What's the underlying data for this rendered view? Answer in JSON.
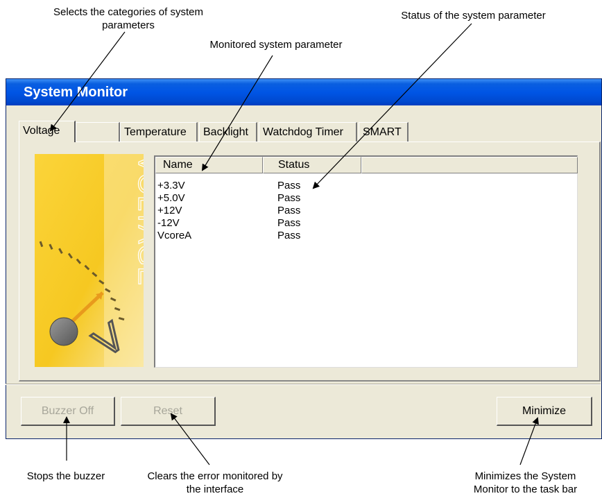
{
  "callouts": {
    "categories": "Selects the categories of system parameters",
    "monitored": "Monitored system parameter",
    "status": "Status of the system parameter",
    "buzzer": "Stops the buzzer",
    "reset": "Clears the error monitored by the interface",
    "minimize": "Minimizes the System Monitor to the task bar"
  },
  "window": {
    "title": "System Monitor"
  },
  "tabs": [
    {
      "label": "Voltage",
      "active": true
    },
    {
      "label": ""
    },
    {
      "label": "Temperature"
    },
    {
      "label": "Backlight"
    },
    {
      "label": "Watchdog Timer"
    },
    {
      "label": "SMART"
    }
  ],
  "artwork": {
    "text": "VOLTAGE",
    "letter": "V"
  },
  "list": {
    "columns": [
      "Name",
      "Status"
    ],
    "rows": [
      {
        "name": "+3.3V",
        "status": "Pass"
      },
      {
        "name": "+5.0V",
        "status": "Pass"
      },
      {
        "name": "+12V",
        "status": "Pass"
      },
      {
        "name": "-12V",
        "status": "Pass"
      },
      {
        "name": "VcoreA",
        "status": "Pass"
      }
    ]
  },
  "buttons": {
    "buzzer_off": "Buzzer Off",
    "reset": "Reset",
    "minimize": "Minimize"
  },
  "colors": {
    "title_bar": "#0055E5",
    "window_bg": "#ECE9D8",
    "artwork": "#F7C928"
  }
}
